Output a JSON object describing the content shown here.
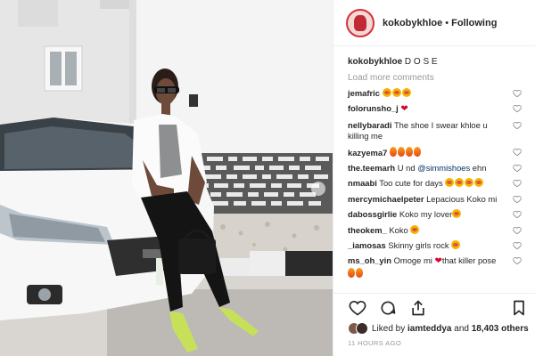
{
  "post": {
    "username": "kokobykhloe",
    "separator": "•",
    "follow_status": "Following"
  },
  "caption": {
    "username": "kokobykhloe",
    "text": "D O S E"
  },
  "load_more_label": "Load more comments",
  "comments": [
    {
      "user": "jemafric",
      "text": "",
      "emoji": [
        "emoji-grin-icon",
        "emoji-grin-icon",
        "emoji-smile-icon"
      ]
    },
    {
      "user": "folorunsho_j",
      "text": "",
      "emoji": [
        "red-heart-icon"
      ]
    },
    {
      "user": "nellybaradi",
      "text": "The shoe I swear khloe u killing me",
      "emoji": []
    },
    {
      "user": "kazyema7",
      "text": "",
      "emoji": [
        "fire-icon",
        "fire-icon",
        "fire-icon",
        "fire-icon"
      ]
    },
    {
      "user": "the.teemarh",
      "text": "U nd ",
      "mention": "@simmishoes",
      "after": " ehn",
      "emoji": []
    },
    {
      "user": "nmaabi",
      "text": "Too cute for days",
      "emoji": [
        "emoji-hearteyes-icon",
        "emoji-hearteyes-icon",
        "emoji-smile-icon",
        "emoji-smile-icon"
      ]
    },
    {
      "user": "mercymichaelpeter",
      "text": "Lepacious Koko mi",
      "emoji": []
    },
    {
      "user": "dabossgirlie",
      "text": "Koko my lover",
      "emoji": [
        "emoji-hearteyes-icon"
      ]
    },
    {
      "user": "theokem_",
      "text": "Koko",
      "emoji": [
        "emoji-hearteyes-icon"
      ]
    },
    {
      "user": "_iamosas",
      "text": "Skinny girls rock",
      "emoji": [
        "emoji-grin-icon"
      ]
    },
    {
      "user": "ms_oh_yin",
      "text": "Omoge mi",
      "after": "that killer pose",
      "emoji": [
        "red-heart-icon"
      ],
      "emoji_after": [
        "fire-icon",
        "fire-icon"
      ]
    }
  ],
  "actions": {
    "like_icon": "heart-outline-icon",
    "comment_icon": "comment-bubble-icon",
    "share_icon": "share-upload-icon",
    "save_icon": "bookmark-icon"
  },
  "likes": {
    "prefix": "Liked by",
    "user": "iamteddya",
    "joiner": "and",
    "count": "18,403 others"
  },
  "timestamp": "11 HOURS AGO",
  "colors": {
    "link": "#003569",
    "muted": "#999999",
    "avatar_ring": "#d52f3d"
  }
}
